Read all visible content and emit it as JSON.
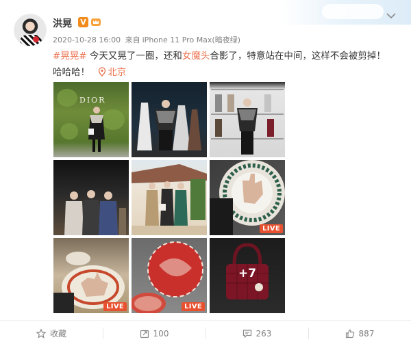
{
  "post": {
    "author": "洪晃",
    "verified_badge": "V",
    "timestamp": "2020-10-28 16:00",
    "source_prefix": "来自",
    "source_device": "iPhone 11 Pro Max(暗夜绿)",
    "hashtag": "#晃晃#",
    "text_part1": " 今天又晃了一圈，还和",
    "text_highlight": "女魔头",
    "text_part2": "合影了，特意站在中间，这样不会被剪掉！",
    "text_line2": "哈哈哈！",
    "location": "北京"
  },
  "images": {
    "brand_text": "DIOR",
    "live_label": "LIVE",
    "more_count": "+7"
  },
  "actions": {
    "favorite_label": "收藏",
    "repost_count": "100",
    "comment_count": "263",
    "like_count": "887"
  },
  "colors": {
    "accent_orange": "#eb7350",
    "live_red": "#e8512f",
    "meta_gray": "#808080"
  }
}
